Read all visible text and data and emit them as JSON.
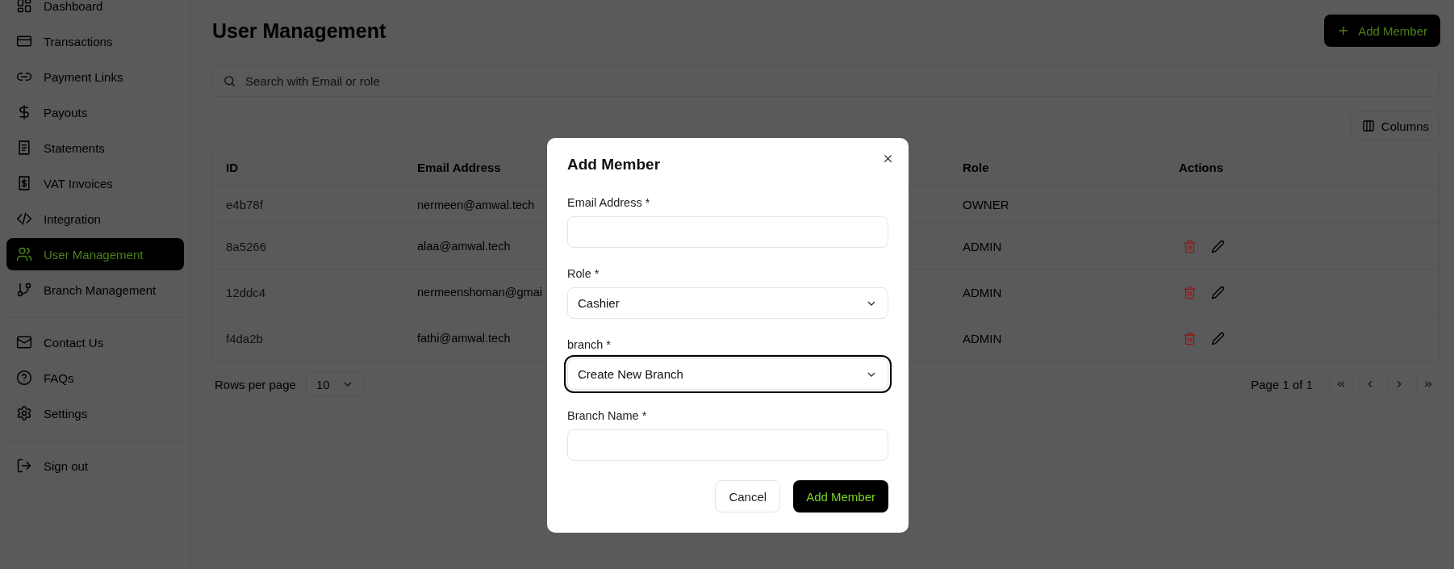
{
  "sidebar": {
    "groups": [
      [
        {
          "label": "Dashboard",
          "selected": false
        },
        {
          "label": "Transactions",
          "selected": false
        },
        {
          "label": "Payment Links",
          "selected": false
        },
        {
          "label": "Payouts",
          "selected": false
        },
        {
          "label": "Statements",
          "selected": false
        },
        {
          "label": "VAT Invoices",
          "selected": false
        },
        {
          "label": "Integration",
          "selected": false
        },
        {
          "label": "User Management",
          "selected": true
        },
        {
          "label": "Branch Management",
          "selected": false
        }
      ],
      [
        {
          "label": "Contact Us",
          "selected": false
        },
        {
          "label": "FAQs",
          "selected": false
        },
        {
          "label": "Settings",
          "selected": false
        }
      ],
      [
        {
          "label": "Sign out",
          "selected": false
        }
      ]
    ]
  },
  "page": {
    "title": "User Management",
    "add_button": "Add Member",
    "search": {
      "placeholder": "Search with Email or role"
    },
    "columns_button": "Columns"
  },
  "table": {
    "columns": [
      "ID",
      "Email Address",
      "Role",
      "Actions"
    ],
    "rows": [
      {
        "id": "e4b78f",
        "email": "nermeen@amwal.tech",
        "role": "OWNER",
        "actions": false
      },
      {
        "id": "8a5266",
        "email": "alaa@amwal.tech",
        "role": "ADMIN",
        "actions": true
      },
      {
        "id": "12ddc4",
        "email": "nermeenshoman@gmai",
        "role": "ADMIN",
        "actions": true
      },
      {
        "id": "f4da2b",
        "email": "fathi@amwal.tech",
        "role": "ADMIN",
        "actions": true
      }
    ]
  },
  "pagination": {
    "rows_label": "Rows per page",
    "rows_value": "10",
    "page_label": "Page 1 of 1"
  },
  "dialog": {
    "title": "Add Member",
    "fields": [
      {
        "kind": "text",
        "label": "Email Address *",
        "focused": false
      },
      {
        "kind": "select",
        "label": "Role *",
        "value": "Cashier",
        "focused": false
      },
      {
        "kind": "select",
        "label": "branch *",
        "value": "Create New Branch",
        "focused": true
      },
      {
        "kind": "text",
        "label": "Branch Name *",
        "focused": false
      }
    ],
    "cancel": "Cancel",
    "submit": "Add Member"
  }
}
